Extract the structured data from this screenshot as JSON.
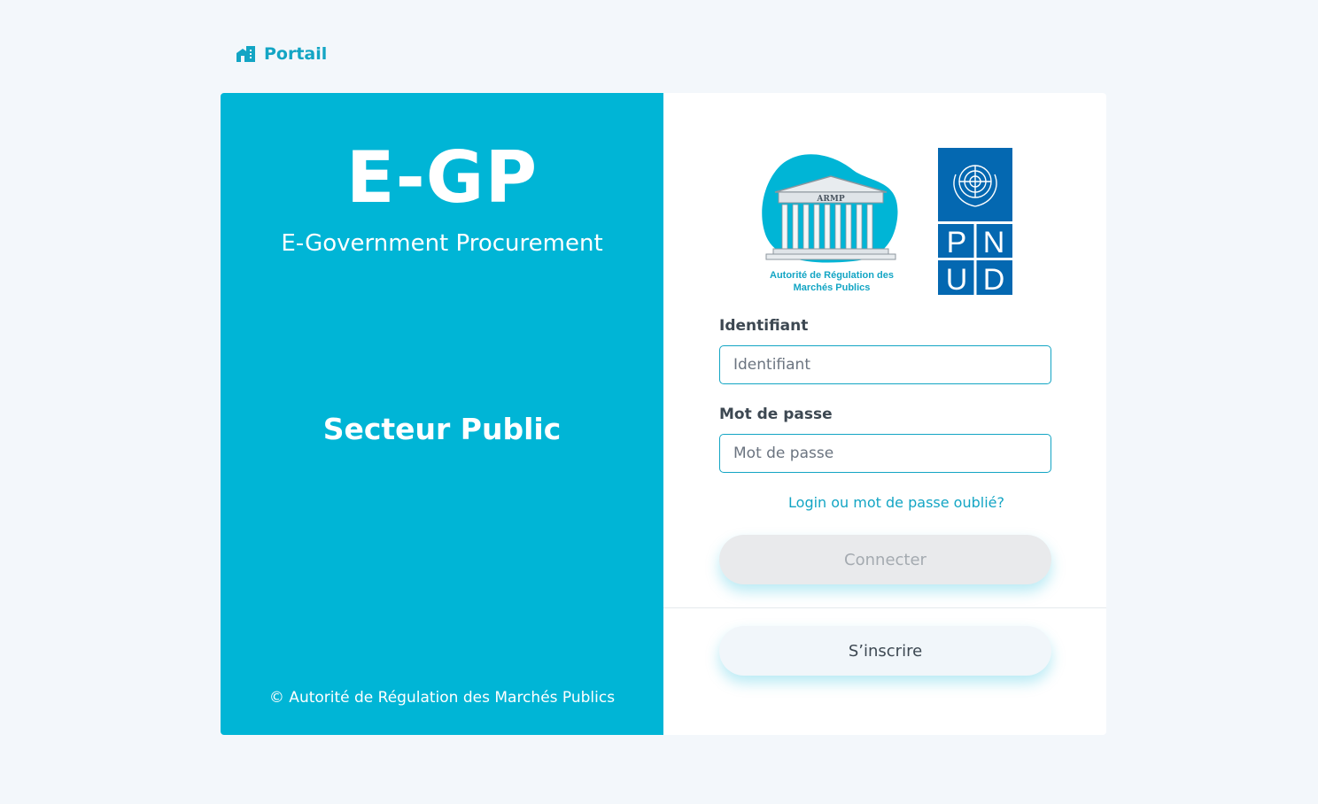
{
  "nav": {
    "portal_label": "Portail",
    "portal_icon": "building-icon"
  },
  "brand": {
    "title": "E-GP",
    "subtitle": "E-Government Procurement",
    "sector": "Secteur Public",
    "copyright": "© Autorité de Régulation des Marchés Publics"
  },
  "logos": {
    "armp": {
      "emblem_text": "ARMP",
      "caption_line1": "Autorité de Régulation des",
      "caption_line2": "Marchés Publics"
    },
    "pnud": {
      "letters": [
        "P",
        "N",
        "U",
        "D"
      ]
    }
  },
  "form": {
    "username_label": "Identifiant",
    "username_placeholder": "Identifiant",
    "password_label": "Mot de passe",
    "password_placeholder": "Mot de passe",
    "forgot_link": "Login ou mot de passe oublié?",
    "connect_button": "Connecter",
    "register_button": "S’inscrire"
  },
  "colors": {
    "accent": "#00b5d6",
    "link": "#13a5c4",
    "pnud_blue": "#0468b1",
    "page_background": "#f3f7fb"
  }
}
